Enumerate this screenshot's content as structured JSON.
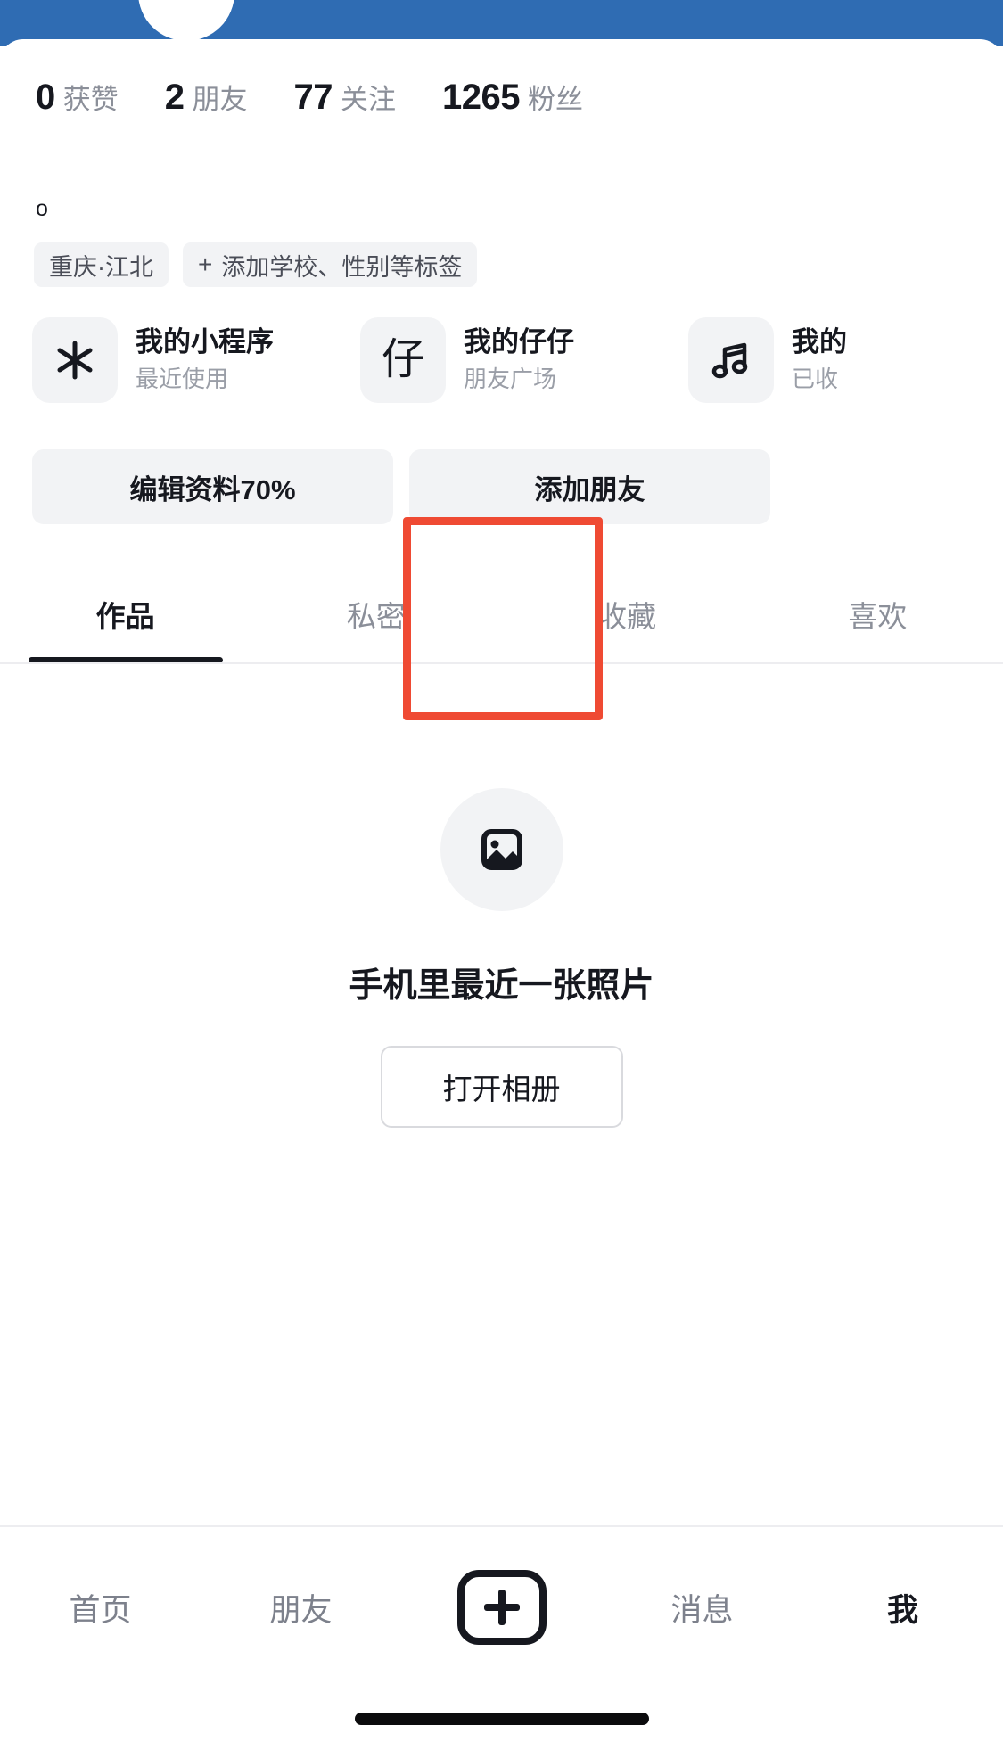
{
  "theme": {
    "header_blue": "#2f6cb3",
    "accent_red": "#ef4a33",
    "text_primary": "#16181f",
    "text_secondary": "#8b8f99",
    "chip_bg": "#f2f3f5"
  },
  "header": {
    "avatar_alt": "avatar"
  },
  "stats": [
    {
      "value": "0",
      "label": "获赞"
    },
    {
      "value": "2",
      "label": "朋友"
    },
    {
      "value": "77",
      "label": "关注"
    },
    {
      "value": "1265",
      "label": "粉丝"
    }
  ],
  "bio": "o",
  "tags": [
    {
      "icon": "",
      "label": "重庆·江北"
    },
    {
      "icon": "+",
      "label": "添加学校、性别等标签"
    }
  ],
  "miniapps": [
    {
      "icon": "mini-program-icon",
      "glyph": "",
      "title": "我的小程序",
      "subtitle": "最近使用"
    },
    {
      "icon": "zaizai-icon",
      "glyph": "仔",
      "title": "我的仔仔",
      "subtitle": "朋友广场"
    },
    {
      "icon": "music-note-icon",
      "glyph": "",
      "title": "我的",
      "subtitle": "已收"
    }
  ],
  "actions": [
    {
      "label": "编辑资料70%"
    },
    {
      "label": "添加朋友"
    }
  ],
  "tabs": [
    {
      "label": "作品",
      "active": true
    },
    {
      "label": "私密",
      "active": false
    },
    {
      "label": "收藏",
      "active": false,
      "highlighted": true
    },
    {
      "label": "喜欢",
      "active": false
    }
  ],
  "empty_state": {
    "icon": "image-placeholder-icon",
    "title": "手机里最近一张照片",
    "button_label": "打开相册"
  },
  "bottom_nav": [
    {
      "label": "首页",
      "active": false
    },
    {
      "label": "朋友",
      "active": false
    },
    {
      "label": "",
      "active": false,
      "icon": "plus-icon"
    },
    {
      "label": "消息",
      "active": false
    },
    {
      "label": "我",
      "active": true
    }
  ]
}
